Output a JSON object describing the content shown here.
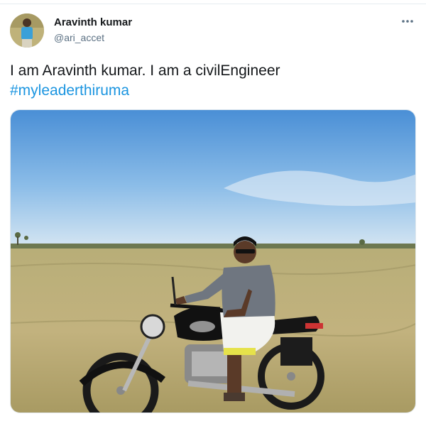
{
  "author": {
    "display_name": "Aravinth kumar",
    "handle": "@ari_accet",
    "avatar_icon": "avatar-photo"
  },
  "tweet": {
    "text_line1": "I am Aravinth kumar. I am a civilEngineer",
    "hashtag": "#myleaderthiruma"
  },
  "actions": {
    "more_icon": "ellipsis-icon"
  },
  "media": {
    "description_icon": "photo-man-on-motorcycle-in-field"
  },
  "colors": {
    "hashtag": "#1b95e0",
    "text": "#14171a",
    "handle": "#5b7083"
  }
}
